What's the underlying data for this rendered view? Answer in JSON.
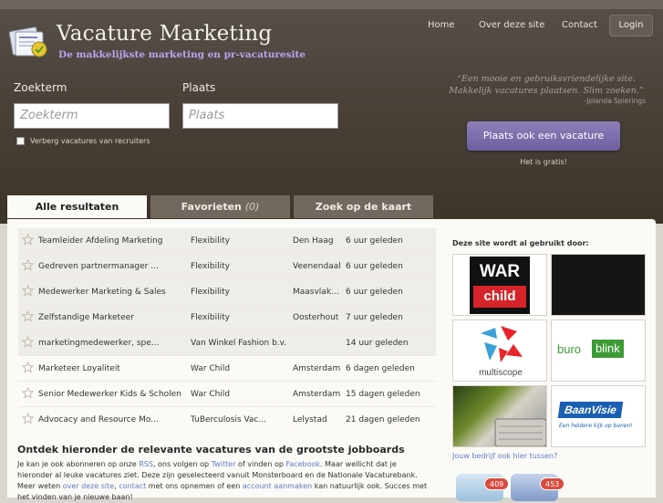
{
  "header": {
    "title": "Vacature Marketing",
    "subtitle": "De makkelijkste marketing en pr-vacaturesite",
    "nav": [
      "Home",
      "Over deze site",
      "Contact"
    ],
    "login": "Login"
  },
  "search": {
    "term_label": "Zoekterm",
    "term_placeholder": "Zoekterm",
    "place_label": "Plaats",
    "place_placeholder": "Plaats",
    "hide_recruiters": "Verberg vacatures van recruiters"
  },
  "promo": {
    "quote": "“Een mooie en gebruiksvriendelijke site. Makkelijk vacatures plaatsen. Slim zoeken.”",
    "author": "-Jolanda Spierings",
    "button": "Plaats ook een vacature",
    "free": "Het is gratis!"
  },
  "tabs": {
    "all": "Alle resultaten",
    "fav": "Favorieten",
    "fav_count": "(0)",
    "map": "Zoek op de kaart"
  },
  "jobs": [
    {
      "title": "Teamleider Afdeling Marketing",
      "company": "Flexibility",
      "city": "Den Haag",
      "when": "6 uur geleden"
    },
    {
      "title": "Gedreven partnermanager ...",
      "company": "Flexibility",
      "city": "Veenendaal",
      "when": "6 uur geleden"
    },
    {
      "title": "Medewerker Marketing & Sales",
      "company": "Flexibility",
      "city": "Maasvlak...",
      "when": "6 uur geleden"
    },
    {
      "title": "Zelfstandige Marketeer",
      "company": "Flexibility",
      "city": "Oosterhout",
      "when": "7 uur geleden"
    },
    {
      "title": "marketingmedewerker, spe...",
      "company": "Van Winkel Fashion b.v.",
      "city": "",
      "when": "14 uur geleden"
    },
    {
      "title": "Marketeer Loyaliteit",
      "company": "War Child",
      "city": "Amsterdam",
      "when": "6 dagen geleden"
    },
    {
      "title": "Senior Medewerker Kids & Scholen",
      "company": "War Child",
      "city": "Amsterdam",
      "when": "15 dagen geleden"
    },
    {
      "title": "Advocacy and Resource Mo...",
      "company": "TuBerculosis Vac...",
      "city": "Lelystad",
      "when": "21 dagen geleden"
    }
  ],
  "section": {
    "heading": "Ontdek hieronder de relevante vacatures van de grootste jobboards",
    "p1": "Je kan je ook abonneren op onze ",
    "rss": "RSS",
    "p2": ", ons volgen op ",
    "twitter": "Twitter",
    "p3": " of vinden op ",
    "facebook": "Facebook",
    "p4": ". Maar wellicht dat je hieronder al leuke vacatures ziet. Deze zijn geselecteerd vanuit Monsterboard en de Nationale Vacaturebank. Meer weten ",
    "about": "over deze site",
    "p5": ", ",
    "contact": "contact",
    "p6": " met ons opnemen of een ",
    "account": "account aanmaken",
    "p7": " kan natuurlijk ook. Succes met het vinden van je nieuwe baan!"
  },
  "sidebar": {
    "title": "Deze site wordt al gebruikt door:",
    "logos": {
      "warchild_1": "WAR",
      "warchild_2": "child",
      "multiscope": "multiscope",
      "buro": "buro",
      "blink": "blink",
      "baanvisie": "BaanVisie",
      "baanvisie_tag": "Een heldere kijk op banen!"
    },
    "caption": "Jouw bedrijf ook hier tussen?"
  },
  "social": {
    "twitter_count": "409",
    "facebook_count": "453"
  },
  "colors": {
    "accent": "#7565a8",
    "link": "#5a7fc4",
    "header_bg": "#4a4239"
  }
}
